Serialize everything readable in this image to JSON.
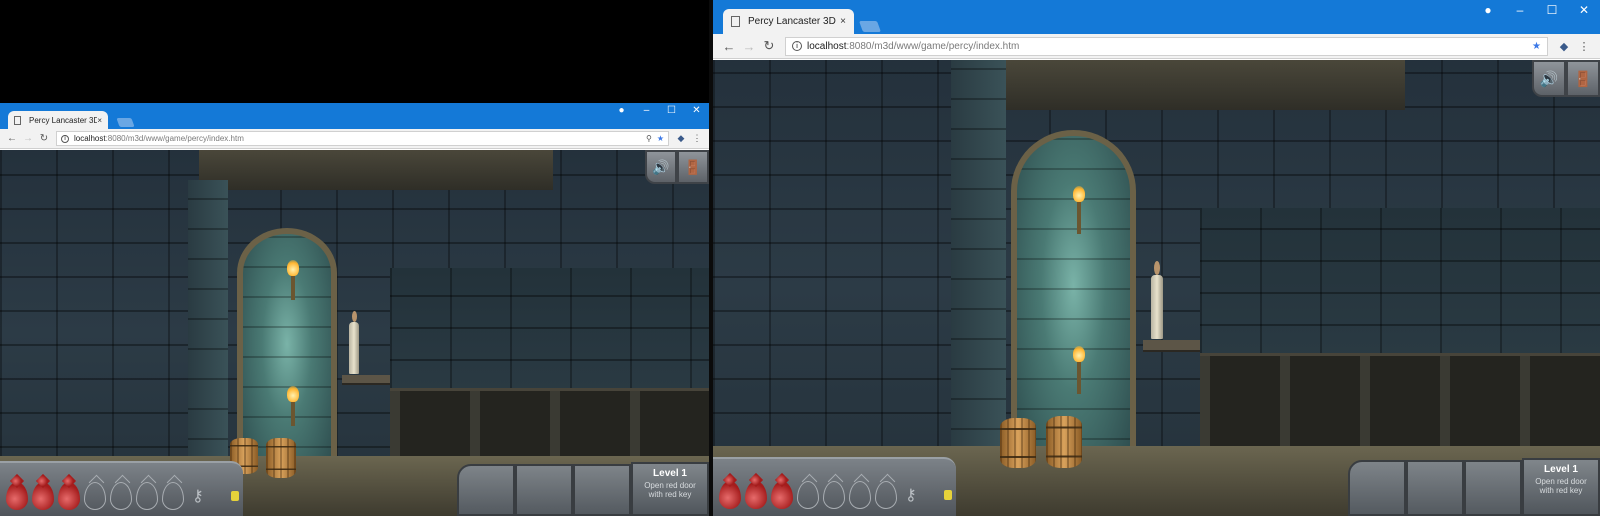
{
  "browser": {
    "tab_title": "Percy Lancaster 3D",
    "tab_close": "×",
    "url_host": "localhost",
    "url_rest": ":8080/m3d/www/game/percy/index.htm",
    "window_controls": {
      "profile": "●",
      "minimize": "–",
      "maximize": "☐",
      "close": "✕"
    },
    "nav": {
      "back": "←",
      "forward": "→",
      "reload": "↻"
    },
    "info_icon": "i",
    "zoom_icon": "⚲",
    "star_icon": "★",
    "extension_icon": "◆",
    "menu_icon": "⋮"
  },
  "game": {
    "hud": {
      "sound_icon": "🔊",
      "exit_icon": "🚪",
      "health": {
        "full": 3,
        "total": 7
      },
      "key_icon": "⚷",
      "level_title": "Level 1",
      "level_objective": "Open red door with red key"
    }
  },
  "icons": [
    "profile-icon",
    "minimize-icon",
    "maximize-icon",
    "close-icon",
    "back-icon",
    "forward-icon",
    "reload-icon",
    "info-icon",
    "zoom-icon",
    "star-icon",
    "extension-icon",
    "menu-icon",
    "sound-icon",
    "exit-icon",
    "key-icon"
  ],
  "colors": {
    "titlebar": "#1479d7",
    "star": "#3b78e7",
    "health_drop": "#a41c1c",
    "hud_led": "#e6d23a"
  }
}
